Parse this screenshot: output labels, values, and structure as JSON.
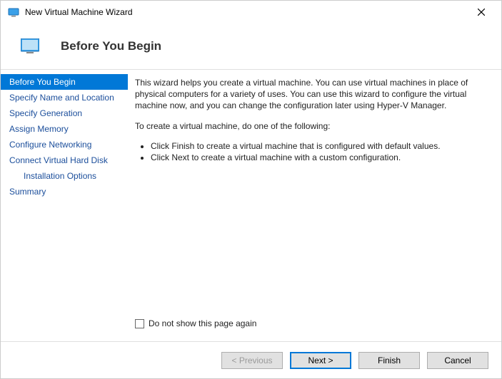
{
  "window": {
    "title": "New Virtual Machine Wizard"
  },
  "header": {
    "title": "Before You Begin"
  },
  "sidebar": {
    "items": [
      {
        "label": "Before You Begin",
        "selected": true
      },
      {
        "label": "Specify Name and Location"
      },
      {
        "label": "Specify Generation"
      },
      {
        "label": "Assign Memory"
      },
      {
        "label": "Configure Networking"
      },
      {
        "label": "Connect Virtual Hard Disk"
      },
      {
        "label": "Installation Options",
        "indent": true
      },
      {
        "label": "Summary"
      }
    ]
  },
  "content": {
    "intro": "This wizard helps you create a virtual machine. You can use virtual machines in place of physical computers for a variety of uses. You can use this wizard to configure the virtual machine now, and you can change the configuration later using Hyper-V Manager.",
    "prompt": "To create a virtual machine, do one of the following:",
    "bullets": [
      "Click Finish to create a virtual machine that is configured with default values.",
      "Click Next to create a virtual machine with a custom configuration."
    ],
    "checkbox_label": "Do not show this page again"
  },
  "footer": {
    "previous": "< Previous",
    "next": "Next >",
    "finish": "Finish",
    "cancel": "Cancel"
  }
}
